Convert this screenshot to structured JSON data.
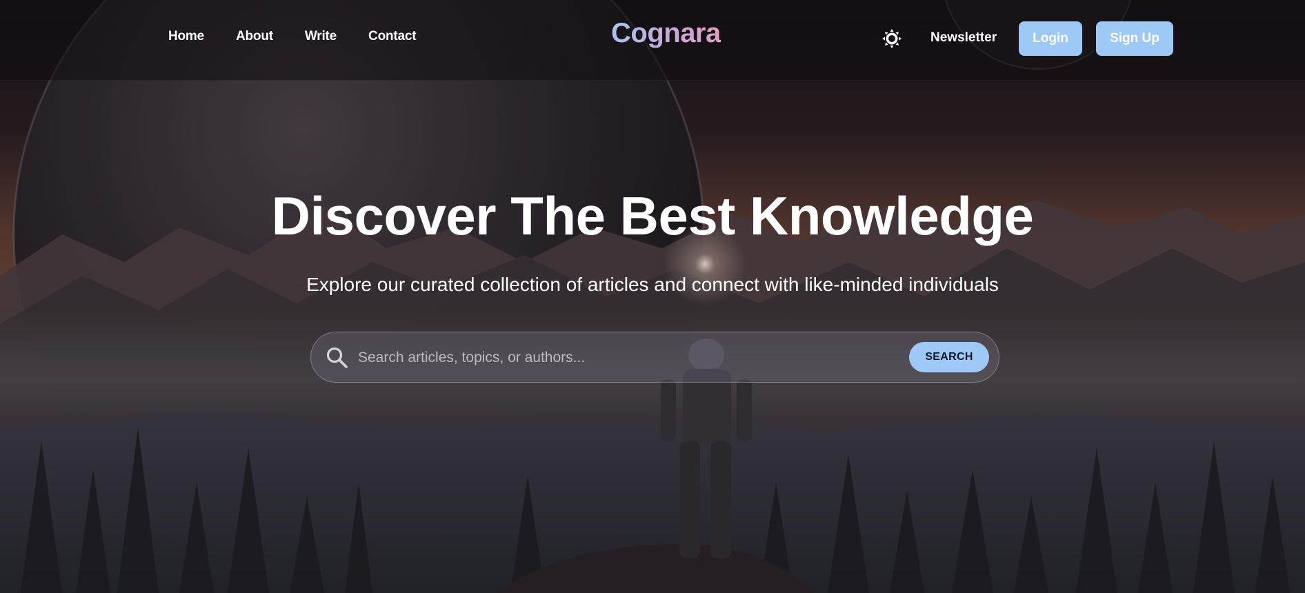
{
  "nav": {
    "links": [
      {
        "label": "Home"
      },
      {
        "label": "About"
      },
      {
        "label": "Write"
      },
      {
        "label": "Contact"
      }
    ],
    "brand": "Cognara",
    "theme_toggle_icon": "sun-icon",
    "newsletter": "Newsletter",
    "login": "Login",
    "signup": "Sign Up"
  },
  "hero": {
    "title": "Discover The Best Knowledge",
    "subtitle": "Explore our curated collection of articles and connect with like-minded individuals",
    "search": {
      "icon": "search-icon",
      "placeholder": "Search articles, topics, or authors...",
      "value": "",
      "button": "SEARCH"
    }
  },
  "colors": {
    "accent": "#9ec8f5",
    "brand_gradient_start": "#a9c4f0",
    "brand_gradient_end": "#e0a0c0",
    "navbar_bg": "#100c10"
  }
}
